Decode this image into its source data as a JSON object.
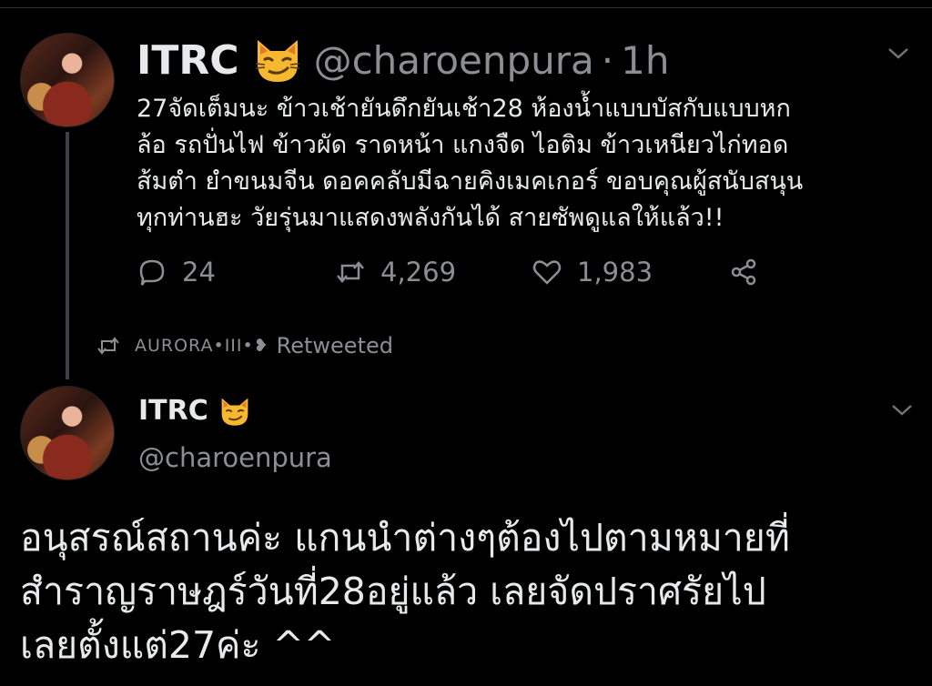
{
  "tweet1": {
    "display_name": "ITRC",
    "handle": "@charoenpura",
    "separator": "·",
    "time": "1h",
    "body_lines": [
      "27จัดเต็มนะ ข้าวเช้ายันดึกยันเช้า28 ห้องน้ำแบบบัสกับแบบหก",
      "ล้อ รถปั่นไฟ ข้าวผัด ราดหน้า แกงจืด ไอติม ข้าวเหนียวไก่ทอด",
      "ส้มตำ ยำขนมจีน ดอคคลับมีฉายคิงเมคเกอร์ ขอบคุณผู้สนับสนุน",
      "ทุกท่านฮะ วัยรุ่นมาแสดงพลังกันได้ สายซัพดูแลให้แล้ว!!"
    ],
    "reply_count": "24",
    "retweet_count": "4,269",
    "like_count": "1,983"
  },
  "retweet_banner": {
    "user": "AURORA•III•❥",
    "label": "Retweeted"
  },
  "tweet2": {
    "display_name": "ITRC",
    "handle": "@charoenpura",
    "body_lines": [
      "อนุสรณ์สถานค่ะ แกนนำต่างๆต้องไปตามหมายที่",
      "สำราญราษฎร์วันที่28อยู่แล้ว เลยจัดปราศรัยไป",
      "เลยตั้งแต่27ค่ะ ^^"
    ]
  },
  "icons": {
    "caret": "chevron-down-icon",
    "emoji": "smirking-cat-emoji",
    "reply": "reply-icon",
    "retweet": "retweet-icon",
    "like": "heart-icon",
    "share": "share-icon"
  },
  "colors": {
    "background": "#000000",
    "text": "#e7e9ea",
    "muted": "#8b8f94",
    "emoji": "#f5b82e"
  }
}
